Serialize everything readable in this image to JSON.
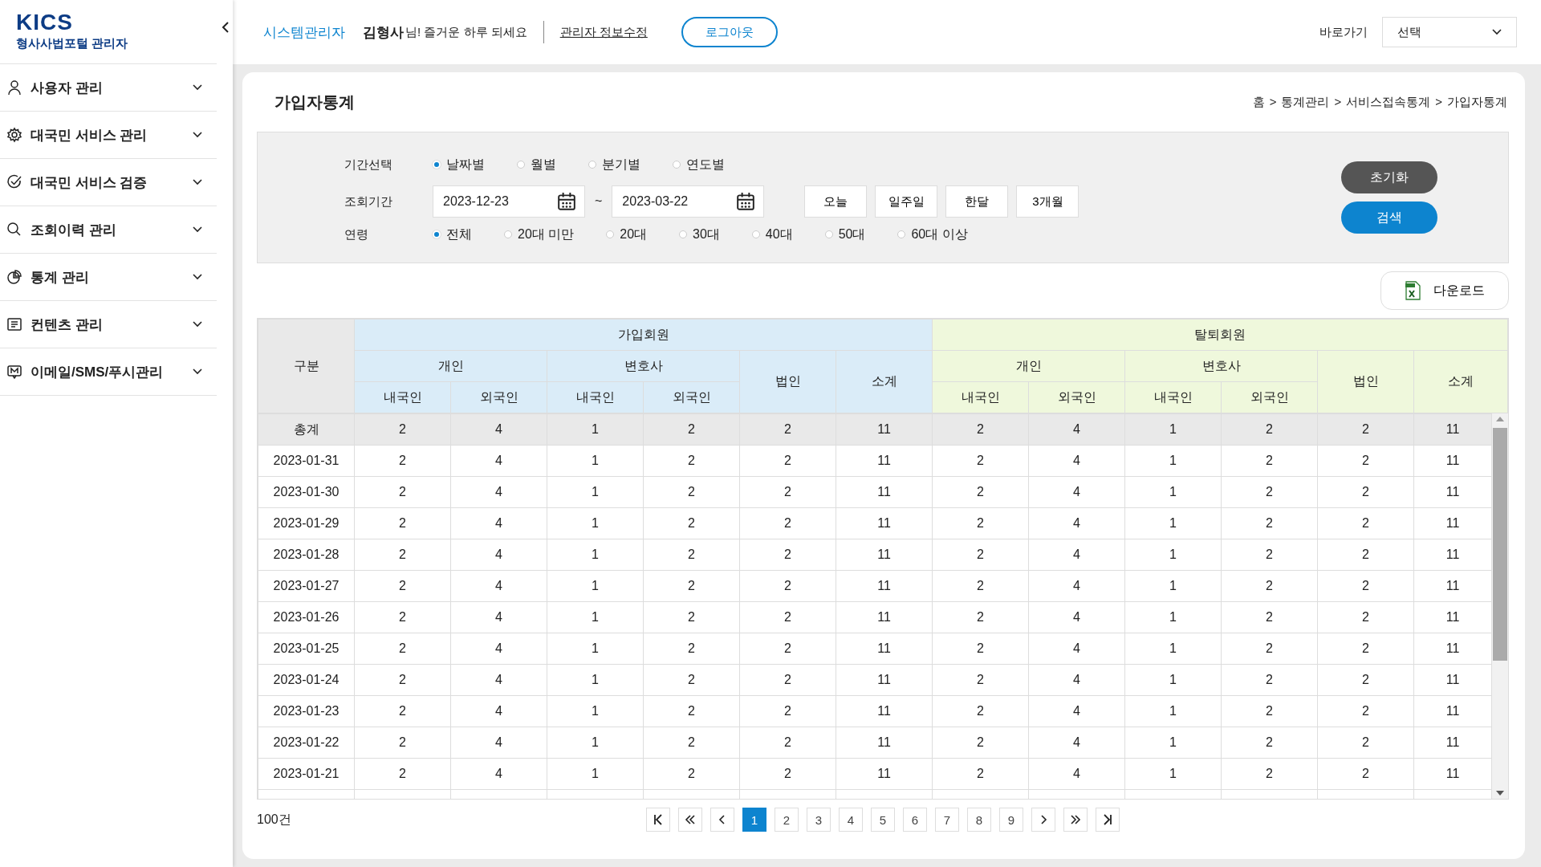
{
  "sidebar": {
    "logo": "KICS",
    "subtitle": "형사사법포털 관리자",
    "items": [
      {
        "label": "사용자 관리",
        "expanded": false
      },
      {
        "label": "대국민 서비스 관리",
        "expanded": false
      },
      {
        "label": "대국민 서비스 검증",
        "expanded": false
      },
      {
        "label": "조회이력 관리",
        "expanded": false
      },
      {
        "label": "통계 관리",
        "expanded": false
      },
      {
        "label": "컨텐츠 관리",
        "expanded": false
      },
      {
        "label": "이메일/SMS/푸시관리",
        "expanded": false
      }
    ]
  },
  "topbar": {
    "role": "시스템관리자",
    "user": "김형사",
    "greeting": "님! 즐거운 하루 되세요",
    "profile_link": "관리자 정보수정",
    "logout": "로그아웃",
    "shortcut_label": "바로가기",
    "shortcut_select": "선택"
  },
  "page": {
    "title": "가입자통계",
    "breadcrumb": [
      "홈",
      "통계관리",
      "서비스접속통계",
      "가입자통계"
    ],
    "breadcrumb_separator": ">"
  },
  "filters": {
    "period": {
      "label": "기간선택",
      "options": [
        {
          "label": "날짜별",
          "selected": true
        },
        {
          "label": "월별",
          "selected": false
        },
        {
          "label": "분기별",
          "selected": false
        },
        {
          "label": "연도별",
          "selected": false
        }
      ]
    },
    "range": {
      "label": "조회기간",
      "start": "2023-12-23",
      "separator": "~",
      "end": "2023-03-22",
      "quick": [
        "오늘",
        "일주일",
        "한달",
        "3개월"
      ]
    },
    "age": {
      "label": "연령",
      "options": [
        {
          "label": "전체",
          "selected": true
        },
        {
          "label": "20대 미만",
          "selected": false
        },
        {
          "label": "20대",
          "selected": false
        },
        {
          "label": "30대",
          "selected": false
        },
        {
          "label": "40대",
          "selected": false
        },
        {
          "label": "50대",
          "selected": false
        },
        {
          "label": "60대 이상",
          "selected": false
        }
      ]
    },
    "reset": "초기화",
    "search": "검색"
  },
  "download": "다운로드",
  "table": {
    "row_header": "구분",
    "groups": [
      {
        "label": "가입회원",
        "kind": "join",
        "subgroups": [
          {
            "label": "개인",
            "columns": [
              "내국인",
              "외국인"
            ]
          },
          {
            "label": "변호사",
            "columns": [
              "내국인",
              "외국인"
            ]
          }
        ],
        "corp": "법인",
        "subtotal": "소계"
      },
      {
        "label": "탈퇴회원",
        "kind": "leave",
        "subgroups": [
          {
            "label": "개인",
            "columns": [
              "내국인",
              "외국인"
            ]
          },
          {
            "label": "변호사",
            "columns": [
              "내국인",
              "외국인"
            ]
          }
        ],
        "corp": "법인",
        "subtotal": "소계"
      }
    ],
    "total": {
      "label": "총계",
      "values": [
        "2",
        "4",
        "1",
        "2",
        "2",
        "11",
        "2",
        "4",
        "1",
        "2",
        "2",
        "11"
      ]
    },
    "rows": [
      {
        "date": "2023-01-31",
        "values": [
          "2",
          "4",
          "1",
          "2",
          "2",
          "11",
          "2",
          "4",
          "1",
          "2",
          "2",
          "11"
        ]
      },
      {
        "date": "2023-01-30",
        "values": [
          "2",
          "4",
          "1",
          "2",
          "2",
          "11",
          "2",
          "4",
          "1",
          "2",
          "2",
          "11"
        ]
      },
      {
        "date": "2023-01-29",
        "values": [
          "2",
          "4",
          "1",
          "2",
          "2",
          "11",
          "2",
          "4",
          "1",
          "2",
          "2",
          "11"
        ]
      },
      {
        "date": "2023-01-28",
        "values": [
          "2",
          "4",
          "1",
          "2",
          "2",
          "11",
          "2",
          "4",
          "1",
          "2",
          "2",
          "11"
        ]
      },
      {
        "date": "2023-01-27",
        "values": [
          "2",
          "4",
          "1",
          "2",
          "2",
          "11",
          "2",
          "4",
          "1",
          "2",
          "2",
          "11"
        ]
      },
      {
        "date": "2023-01-26",
        "values": [
          "2",
          "4",
          "1",
          "2",
          "2",
          "11",
          "2",
          "4",
          "1",
          "2",
          "2",
          "11"
        ]
      },
      {
        "date": "2023-01-25",
        "values": [
          "2",
          "4",
          "1",
          "2",
          "2",
          "11",
          "2",
          "4",
          "1",
          "2",
          "2",
          "11"
        ]
      },
      {
        "date": "2023-01-24",
        "values": [
          "2",
          "4",
          "1",
          "2",
          "2",
          "11",
          "2",
          "4",
          "1",
          "2",
          "2",
          "11"
        ]
      },
      {
        "date": "2023-01-23",
        "values": [
          "2",
          "4",
          "1",
          "2",
          "2",
          "11",
          "2",
          "4",
          "1",
          "2",
          "2",
          "11"
        ]
      },
      {
        "date": "2023-01-22",
        "values": [
          "2",
          "4",
          "1",
          "2",
          "2",
          "11",
          "2",
          "4",
          "1",
          "2",
          "2",
          "11"
        ]
      },
      {
        "date": "2023-01-21",
        "values": [
          "2",
          "4",
          "1",
          "2",
          "2",
          "11",
          "2",
          "4",
          "1",
          "2",
          "2",
          "11"
        ]
      }
    ]
  },
  "pagination": {
    "count": "100건",
    "pages": [
      {
        "label": "1",
        "selected": true
      },
      {
        "label": "2",
        "selected": false
      },
      {
        "label": "3",
        "selected": false
      },
      {
        "label": "4",
        "selected": false
      },
      {
        "label": "5",
        "selected": false
      },
      {
        "label": "6",
        "selected": false
      },
      {
        "label": "7",
        "selected": false
      },
      {
        "label": "8",
        "selected": false
      },
      {
        "label": "9",
        "selected": false
      }
    ]
  }
}
